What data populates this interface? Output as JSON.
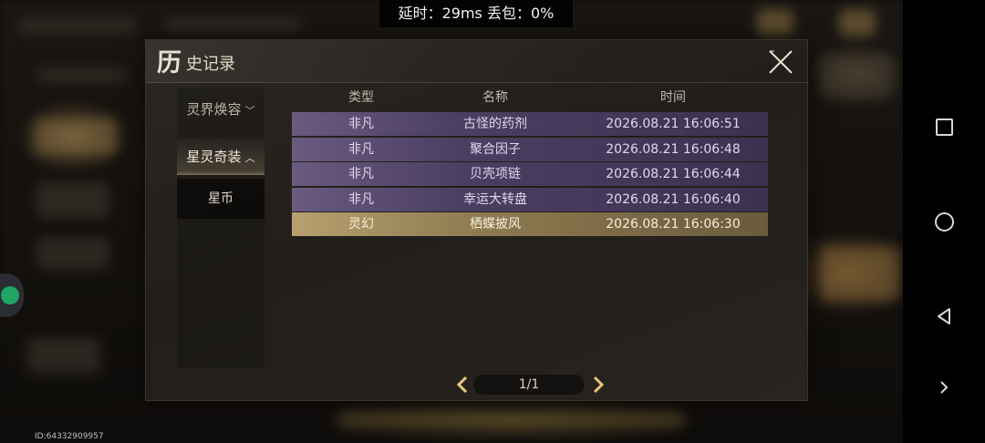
{
  "network": {
    "status": "延时：29ms 丢包：0%"
  },
  "dialog": {
    "title_big": "历",
    "title_rest": "史记录",
    "close_icon": "close-icon"
  },
  "sidebar": {
    "category1": "灵界焕容",
    "category2": "星灵奇装",
    "sub_item": "星币"
  },
  "table": {
    "headers": [
      "类型",
      "名称",
      "时间"
    ],
    "rows": [
      {
        "type": "非凡",
        "name": "古怪的药剂",
        "time": "2026.08.21  16:06:51",
        "rarity_color": "#5a4a72"
      },
      {
        "type": "非凡",
        "name": "聚合因子",
        "time": "2026.08.21  16:06:48",
        "rarity_color": "#5a4a72"
      },
      {
        "type": "非凡",
        "name": "贝壳项链",
        "time": "2026.08.21  16:06:44",
        "rarity_color": "#5a4a72"
      },
      {
        "type": "非凡",
        "name": "幸运大转盘",
        "time": "2026.08.21  16:06:40",
        "rarity_color": "#5a4a72"
      },
      {
        "type": "灵幻",
        "name": "栖蝶披风",
        "time": "2026.08.21  16:06:30",
        "rarity_color": "#a08a5a"
      }
    ]
  },
  "pager": {
    "label": "1/1"
  },
  "device": {
    "id": "ID:64332909957"
  },
  "icons": {
    "nav_recent": "square-icon",
    "nav_home": "circle-icon",
    "nav_back": "back-triangle-icon",
    "nav_more": "chevron-right-icon"
  }
}
